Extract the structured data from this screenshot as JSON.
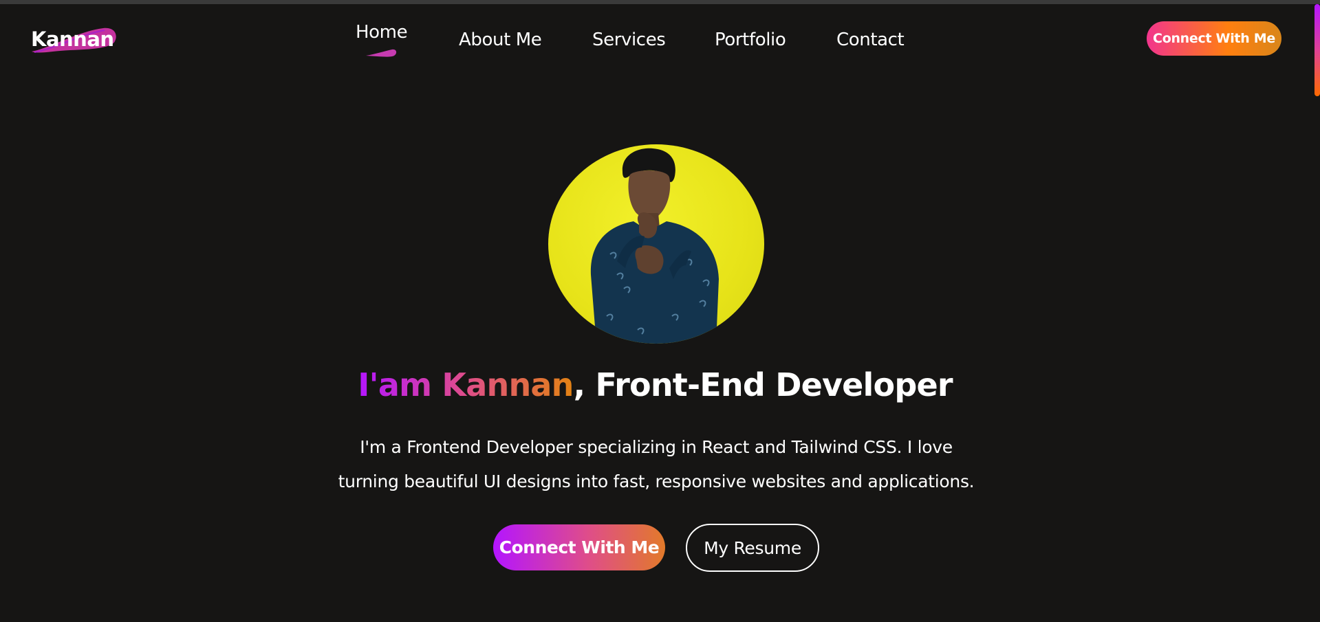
{
  "nav": {
    "logo_text": "Kannan",
    "items": [
      {
        "label": "Home",
        "active": true
      },
      {
        "label": "About Me",
        "active": false
      },
      {
        "label": "Services",
        "active": false
      },
      {
        "label": "Portfolio",
        "active": false
      },
      {
        "label": "Contact",
        "active": false
      }
    ],
    "cta_label": "Connect With Me"
  },
  "hero": {
    "headline_highlight": "I'am Kannan",
    "headline_rest": ", Front-End Developer",
    "intro_line1": "I'm a Frontend Developer specializing in React and Tailwind CSS. I love",
    "intro_line2": "turning beautiful UI designs into fast, responsive websites and applications.",
    "primary_button": "Connect With Me",
    "secondary_button": "My Resume"
  },
  "colors": {
    "background": "#161514",
    "gradient_purple": "#b415ff",
    "gradient_pink": "#df4d8a",
    "gradient_orange": "#e38312",
    "avatar_bg": "#e7e319"
  },
  "icons": {
    "home_underline": "underline-swoosh-icon",
    "logo_blob": "logo-blob-icon"
  }
}
